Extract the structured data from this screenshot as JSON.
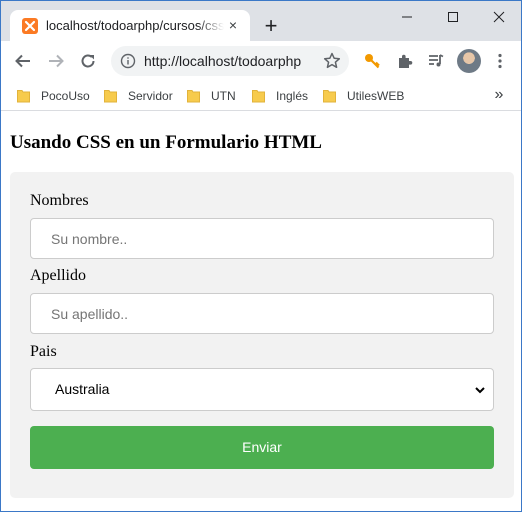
{
  "browser": {
    "tab": {
      "title": "localhost/todoarphp/cursos/css/",
      "favicon": "xampp-icon"
    },
    "address": {
      "url": "http://localhost/todoarphp"
    },
    "bookmarks": [
      "PocoUso",
      "Servidor",
      "UTN",
      "Inglés",
      "UtilesWEB"
    ],
    "bookmarks_more": "»",
    "new_tab": "+",
    "close_tab": "×"
  },
  "page": {
    "title": "Usando CSS en un Formulario HTML",
    "form": {
      "nombres": {
        "label": "Nombres",
        "placeholder": "Su nombre..",
        "value": ""
      },
      "apellido": {
        "label": "Apellido",
        "placeholder": "Su apellido..",
        "value": ""
      },
      "pais": {
        "label": "Pais",
        "selected": "Australia"
      },
      "submit_label": "Enviar"
    }
  },
  "colors": {
    "submit_button": "#4caf50",
    "form_background": "#f2f2f2",
    "tab_strip": "#dee1e6",
    "favicon": "#fb7a24",
    "key_icon": "#f29900"
  }
}
